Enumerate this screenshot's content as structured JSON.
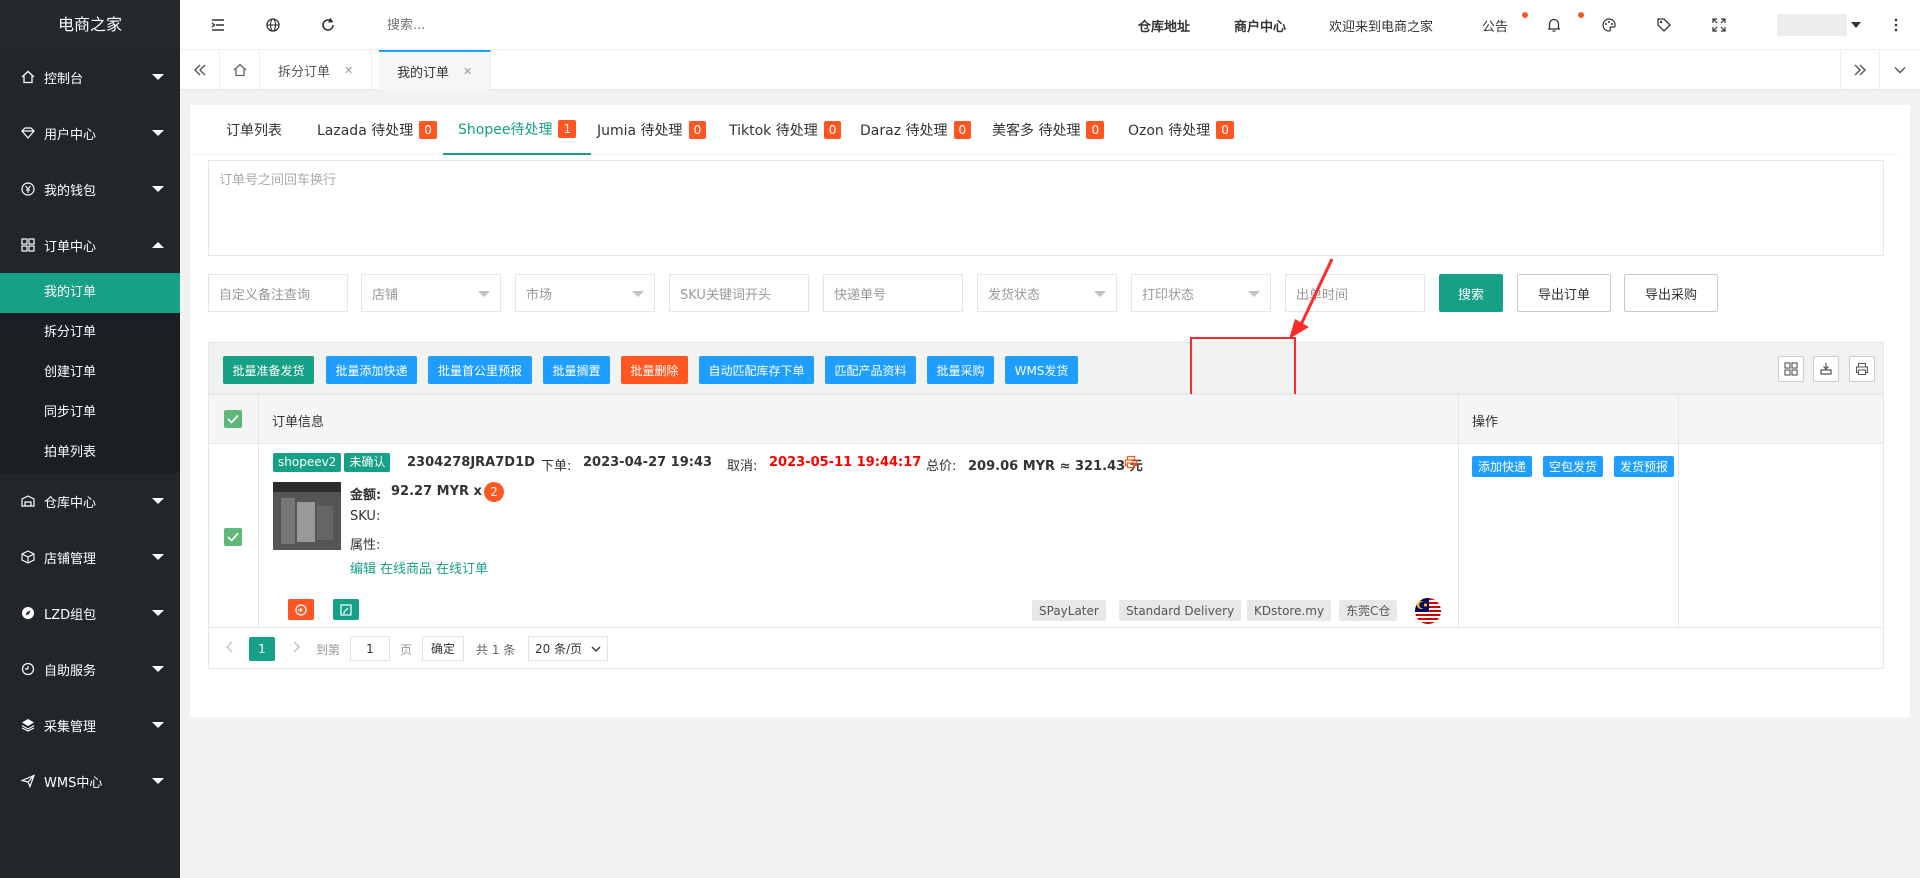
{
  "sidebar": {
    "logo": "电商之家",
    "items": [
      {
        "label": "控制台",
        "icon": "home-icon"
      },
      {
        "label": "用户中心",
        "icon": "diamond-icon"
      },
      {
        "label": "我的钱包",
        "icon": "yen-icon"
      },
      {
        "label": "订单中心",
        "icon": "grid-icon",
        "expanded": true,
        "children": [
          "我的订单",
          "拆分订单",
          "创建订单",
          "同步订单",
          "拍单列表"
        ],
        "active_child": 0
      },
      {
        "label": "仓库中心",
        "icon": "warehouse-icon"
      },
      {
        "label": "店铺管理",
        "icon": "box-icon"
      },
      {
        "label": "LZD组包",
        "icon": "compass-icon"
      },
      {
        "label": "自助服务",
        "icon": "service-icon"
      },
      {
        "label": "采集管理",
        "icon": "layers-icon"
      },
      {
        "label": "WMS中心",
        "icon": "send-icon"
      }
    ]
  },
  "header": {
    "search_placeholder": "搜索...",
    "links": {
      "warehouse": "仓库地址",
      "merchant": "商户中心",
      "welcome": "欢迎来到电商之家",
      "notice": "公告"
    }
  },
  "tabbar": {
    "tabs": [
      {
        "label": "拆分订单",
        "active": false
      },
      {
        "label": "我的订单",
        "active": true
      }
    ]
  },
  "subtabs": [
    {
      "label": "订单列表",
      "badge": null
    },
    {
      "label": "Lazada 待处理",
      "badge": "0"
    },
    {
      "label": "Shopee待处理",
      "badge": "1",
      "active": true
    },
    {
      "label": "Jumia 待处理",
      "badge": "0"
    },
    {
      "label": "Tiktok 待处理",
      "badge": "0"
    },
    {
      "label": "Daraz 待处理",
      "badge": "0"
    },
    {
      "label": "美客多 待处理",
      "badge": "0"
    },
    {
      "label": "Ozon 待处理",
      "badge": "0"
    }
  ],
  "textarea_placeholder": "订单号之间回车换行",
  "filters": {
    "remark": "自定义备注查询",
    "shop": "店铺",
    "market": "市场",
    "sku": "SKU关键词开头",
    "tracking": "快递单号",
    "ship_status": "发货状态",
    "print_status": "打印状态",
    "out_time": "出单时间"
  },
  "buttons": {
    "search": "搜索",
    "export_order": "导出订单",
    "export_purchase": "导出采购"
  },
  "toolbar": {
    "buttons": [
      {
        "label": "批量准备发货",
        "color": "#16a085"
      },
      {
        "label": "批量添加快递",
        "color": "#1e9fff"
      },
      {
        "label": "批量首公里预报",
        "color": "#1e9fff"
      },
      {
        "label": "批量搁置",
        "color": "#1e9fff"
      },
      {
        "label": "批量删除",
        "color": "#ff5722"
      },
      {
        "label": "自动匹配库存下单",
        "color": "#1e9fff"
      },
      {
        "label": "匹配产品资料",
        "color": "#1e9fff"
      },
      {
        "label": "批量采购",
        "color": "#1e9fff"
      },
      {
        "label": "WMS发货",
        "color": "#1e9fff"
      }
    ]
  },
  "table": {
    "col_info": "订单信息",
    "col_action": "操作"
  },
  "order": {
    "platform_tag": "shopeev2",
    "status_tag": "未确认",
    "order_no": "2304278JRA7D1D",
    "order_label": "下单:",
    "order_time": "2023-04-27 19:43",
    "cancel_label": "取消:",
    "cancel_time": "2023-05-11 19:44:17",
    "total_label": "总价:",
    "total": "209.06 MYR ≈ 321.43 元",
    "amount_label": "金额:",
    "amount": "92.27 MYR x",
    "qty": "2",
    "sku_label": "SKU:",
    "attr_label": "属性:",
    "links": [
      "编辑",
      "在线商品",
      "在线订单"
    ],
    "actions": [
      "添加快递",
      "空包发货",
      "发货预报"
    ],
    "tags": [
      "SPayLater",
      "Standard Delivery",
      "KDstore.my",
      "东莞C仓"
    ]
  },
  "pager": {
    "current": "1",
    "goto_label": "到第",
    "goto_value": "1",
    "page_label": "页",
    "confirm": "确定",
    "total": "共 1 条",
    "per_page": "20 条/页"
  },
  "colors": {
    "primary": "#16a085",
    "blue": "#1e9fff",
    "red": "#ff5722",
    "sidebar": "#22262b"
  }
}
